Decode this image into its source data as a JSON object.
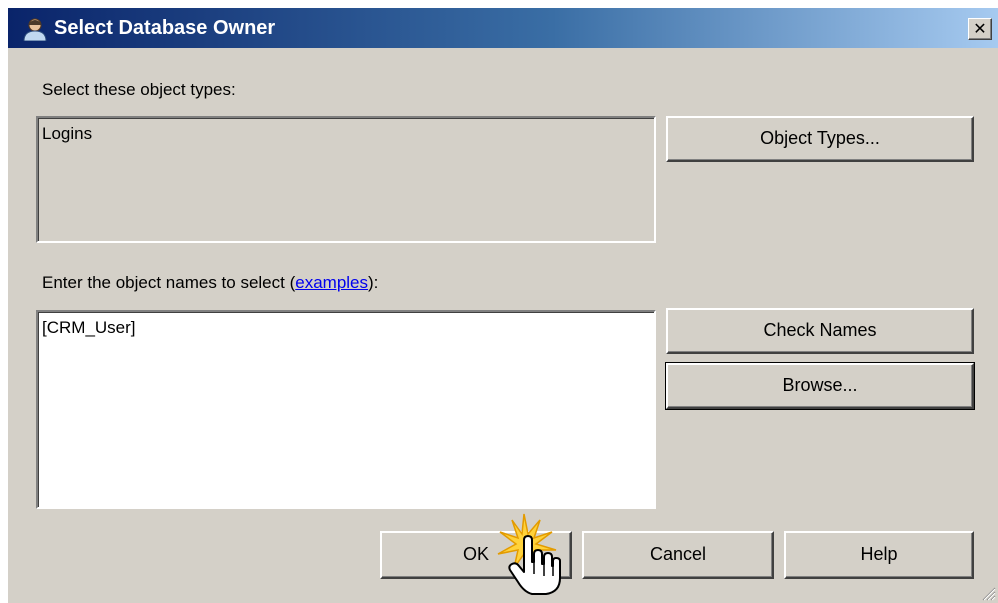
{
  "window": {
    "title": "Select Database Owner",
    "close_label": "✕"
  },
  "object_types": {
    "label": "Select these object types:",
    "value": "Logins",
    "button_label": "Object Types..."
  },
  "object_names": {
    "label_prefix": "Enter the object names to select (",
    "examples_link": "examples",
    "label_suffix": "):",
    "value": "[CRM_User]",
    "check_names_label": "Check Names",
    "browse_label": "Browse..."
  },
  "footer": {
    "ok_label": "OK",
    "cancel_label": "Cancel",
    "help_label": "Help"
  }
}
